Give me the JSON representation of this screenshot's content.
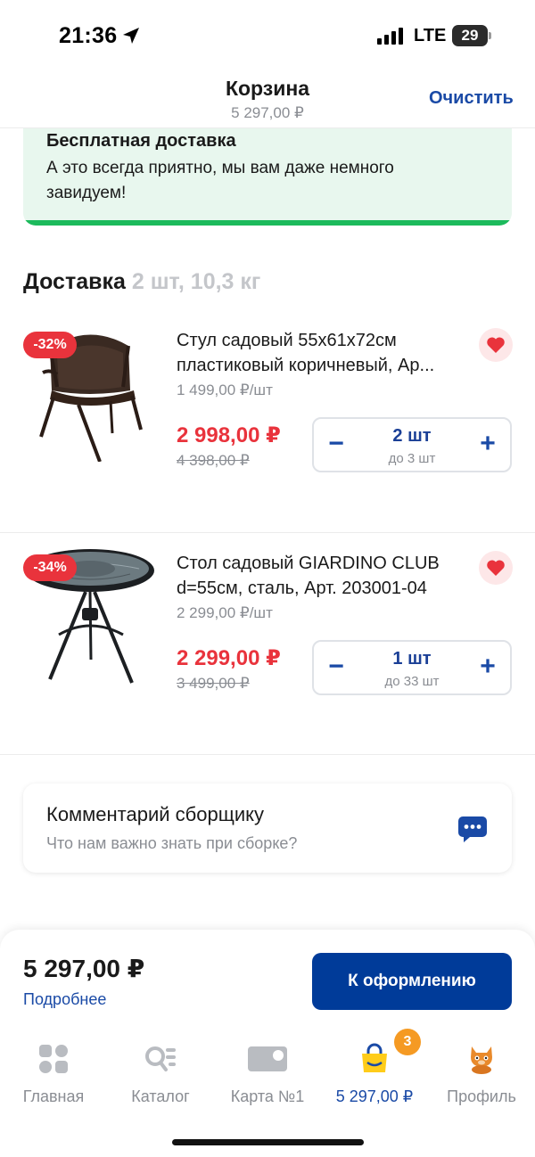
{
  "status_bar": {
    "time": "21:36",
    "network": "LTE",
    "battery": "29"
  },
  "header": {
    "title": "Корзина",
    "subtitle": "5 297,00 ₽",
    "clear_label": "Очистить"
  },
  "banner": {
    "title": "Бесплатная доставка",
    "text": "А это всегда приятно, мы вам даже немного завидуем!",
    "accent_color": "#1cba5c"
  },
  "delivery_section": {
    "title": "Доставка",
    "meta": "2 шт, 10,3 кг"
  },
  "items": [
    {
      "discount": "-32%",
      "title": "Стул садовый 55х61х72см пластиковый коричневый, Ар...",
      "unit_price": "1 499,00 ₽/шт",
      "price": "2 998,00 ₽",
      "old_price": "4 398,00 ₽",
      "quantity": "2 шт",
      "max_quantity": "до 3 шт",
      "favorite": true
    },
    {
      "discount": "-34%",
      "title": "Стол садовый GIARDINO CLUB d=55см, сталь, Арт. 203001-04",
      "unit_price": "2 299,00 ₽/шт",
      "price": "2 299,00 ₽",
      "old_price": "3 499,00 ₽",
      "quantity": "1 шт",
      "max_quantity": "до 33 шт",
      "favorite": true
    }
  ],
  "stepper": {
    "minus": "−",
    "plus": "+"
  },
  "comment": {
    "title": "Комментарий сборщику",
    "placeholder": "Что нам важно знать при сборке?"
  },
  "checkout": {
    "total": "5 297,00 ₽",
    "details_label": "Подробнее",
    "button_label": "К оформлению",
    "button_color": "#003b99"
  },
  "tabs": [
    {
      "label": "Главная",
      "icon": "home-grid-icon",
      "active": false
    },
    {
      "label": "Каталог",
      "icon": "catalog-search-icon",
      "active": false
    },
    {
      "label": "Карта №1",
      "icon": "loyalty-card-icon",
      "active": false
    },
    {
      "label": "5 297,00 ₽",
      "icon": "cart-bag-icon",
      "active": true,
      "badge": "3"
    },
    {
      "label": "Профиль",
      "icon": "profile-cat-icon",
      "active": false
    }
  ],
  "colors": {
    "accent_blue": "#1a4aa6",
    "sale_red": "#e9333c",
    "badge_orange": "#f59a23"
  }
}
